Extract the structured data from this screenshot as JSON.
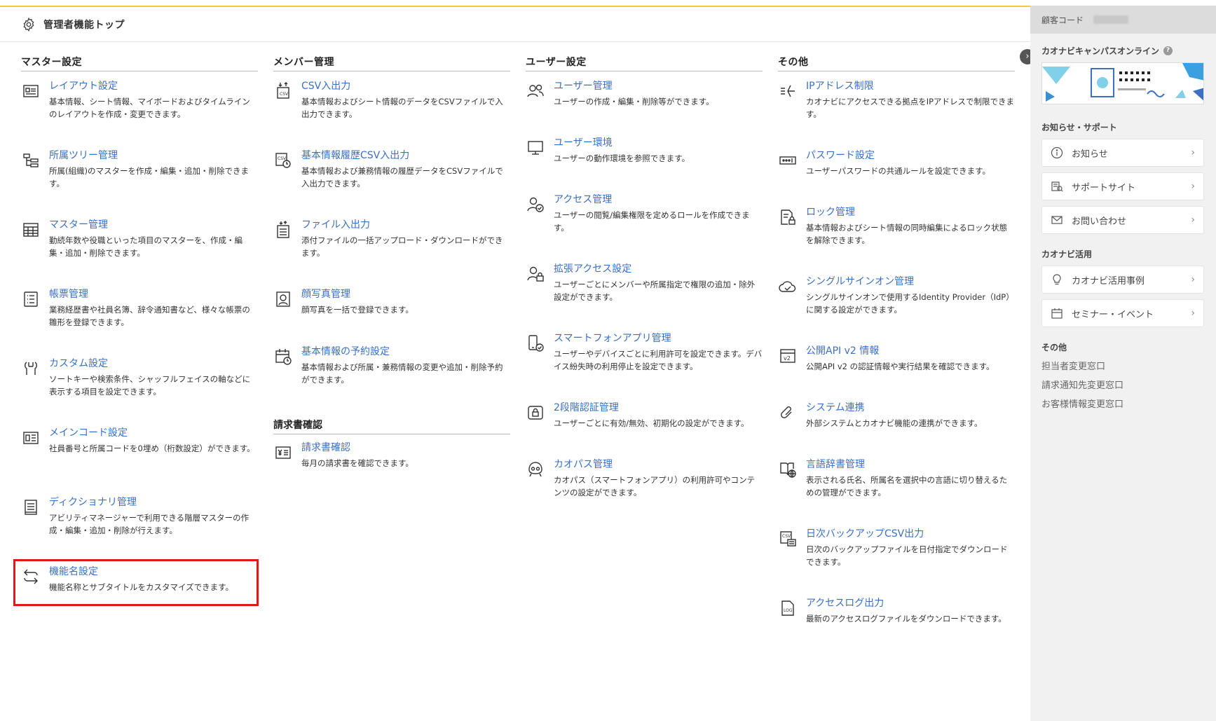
{
  "header": {
    "title": "管理者機能トップ"
  },
  "columns": [
    {
      "heading": "マスター設定",
      "items": [
        {
          "label": "レイアウト設定",
          "desc": "基本情報、シート情報、マイボードおよびタイムラインのレイアウトを作成・変更できます。"
        },
        {
          "label": "所属ツリー管理",
          "desc": "所属(組織)のマスターを作成・編集・追加・削除できます。"
        },
        {
          "label": "マスター管理",
          "desc": "勤続年数や役職といった項目のマスターを、作成・編集・追加・削除できます。"
        },
        {
          "label": "帳票管理",
          "desc": "業務経歴書や社員名簿、辞令通知書など、様々な帳票の雛形を登録できます。"
        },
        {
          "label": "カスタム設定",
          "desc": "ソートキーや検索条件、シャッフルフェイスの軸などに表示する項目を設定できます。"
        },
        {
          "label": "メインコード設定",
          "desc": "社員番号と所属コードを0埋め（桁数設定）ができます。"
        },
        {
          "label": "ディクショナリ管理",
          "desc": "アビリティマネージャーで利用できる階層マスターの作成・編集・追加・削除が行えます。"
        },
        {
          "label": "機能名設定",
          "desc": "機能名称とサブタイトルをカスタマイズできます。"
        }
      ]
    },
    {
      "heading": "メンバー管理",
      "items": [
        {
          "label": "CSV入出力",
          "desc": "基本情報およびシート情報のデータをCSVファイルで入出力できます。"
        },
        {
          "label": "基本情報履歴CSV入出力",
          "desc": "基本情報および兼務情報の履歴データをCSVファイルで入出力できます。"
        },
        {
          "label": "ファイル入出力",
          "desc": "添付ファイルの一括アップロード・ダウンロードができます。"
        },
        {
          "label": "顔写真管理",
          "desc": "顔写真を一括で登録できます。"
        },
        {
          "label": "基本情報の予約設定",
          "desc": "基本情報および所属・兼務情報の変更や追加・削除予約ができます。"
        }
      ],
      "sub_heading": "請求書確認",
      "sub_items": [
        {
          "label": "請求書確認",
          "desc": "毎月の請求書を確認できます。"
        }
      ]
    },
    {
      "heading": "ユーザー設定",
      "items": [
        {
          "label": "ユーザー管理",
          "desc": "ユーザーの作成・編集・削除等ができます。"
        },
        {
          "label": "ユーザー環境",
          "desc": "ユーザーの動作環境を参照できます。"
        },
        {
          "label": "アクセス管理",
          "desc": "ユーザーの閲覧/編集権限を定めるロールを作成できます。"
        },
        {
          "label": "拡張アクセス設定",
          "desc": "ユーザーごとにメンバーや所属指定で権限の追加・除外設定ができます。"
        },
        {
          "label": "スマートフォンアプリ管理",
          "desc": "ユーザーやデバイスごとに利用許可を設定できます。デバイス紛失時の利用停止を設定できます。"
        },
        {
          "label": "2段階認証管理",
          "desc": "ユーザーごとに有効/無効、初期化の設定ができます。"
        },
        {
          "label": "カオパス管理",
          "desc": "カオパス（スマートフォンアプリ）の利用許可やコンテンツの設定ができます。"
        }
      ]
    },
    {
      "heading": "その他",
      "items": [
        {
          "label": "IPアドレス制限",
          "desc": "カオナビにアクセスできる拠点をIPアドレスで制限できます。"
        },
        {
          "label": "パスワード設定",
          "desc": "ユーザーパスワードの共通ルールを設定できます。"
        },
        {
          "label": "ロック管理",
          "desc": "基本情報およびシート情報の同時編集によるロック状態を解除できます。"
        },
        {
          "label": "シングルサインオン管理",
          "desc": "シングルサインオンで使用するIdentity Provider（IdP）に関する設定ができます。"
        },
        {
          "label": "公開API v2 情報",
          "desc": "公開API v2 の認証情報や実行結果を確認できます。"
        },
        {
          "label": "システム連携",
          "desc": "外部システムとカオナビ機能の連携ができます。"
        },
        {
          "label": "言語辞書管理",
          "desc": "表示される氏名、所属名を選択中の言語に切り替えるための管理ができます。"
        },
        {
          "label": "日次バックアップCSV出力",
          "desc": "日次のバックアップファイルを日付指定でダウンロードできます。"
        },
        {
          "label": "アクセスログ出力",
          "desc": "最新のアクセスログファイルをダウンロードできます。"
        }
      ]
    }
  ],
  "sidebar": {
    "customer_code_label": "顧客コード",
    "campus_title": "カオナビキャンパスオンライン",
    "help_glyph": "?",
    "collapse_glyph": "›",
    "support_title": "お知らせ・サポート",
    "support_items": [
      {
        "label": "お知らせ",
        "icon": "info-icon"
      },
      {
        "label": "サポートサイト",
        "icon": "book-icon"
      },
      {
        "label": "お問い合わせ",
        "icon": "mail-icon"
      }
    ],
    "use_title": "カオナビ活用",
    "use_items": [
      {
        "label": "カオナビ活用事例",
        "icon": "lightbulb-icon"
      },
      {
        "label": "セミナー・イベント",
        "icon": "calendar-icon"
      }
    ],
    "other_title": "その他",
    "other_links": [
      "担当者変更窓口",
      "請求通知先変更窓口",
      "お客様情報変更窓口"
    ],
    "chevron": "›"
  },
  "colors": {
    "link": "#3a6fc2",
    "highlight": "#e01818",
    "accent": "#f5c842"
  }
}
